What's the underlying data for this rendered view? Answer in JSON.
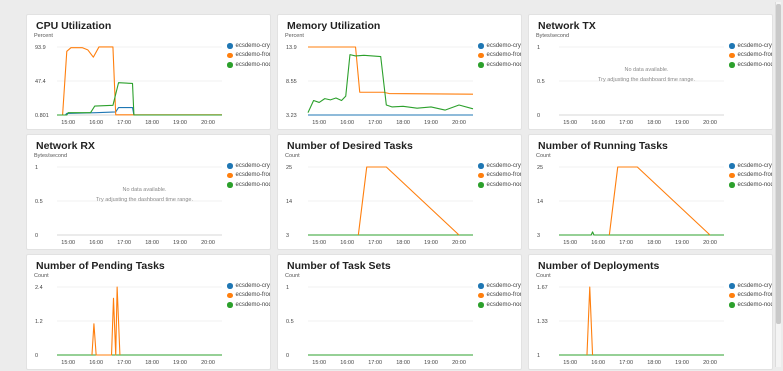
{
  "colors": {
    "crystal": "#1f77b4",
    "frontend": "#ff7f0e",
    "nodejs": "#2ca02c"
  },
  "time_ticks": [
    "15:00",
    "16:00",
    "17:00",
    "18:00",
    "19:00",
    "20:00"
  ],
  "widgets": [
    {
      "title": "CPU Utilization",
      "unit": "Percent",
      "yticks": [
        "93.9",
        "47.4",
        "0.801"
      ],
      "yrange": [
        0.801,
        93.9
      ],
      "legend": [
        "ecsdemo-crystal",
        "ecsdemo-frontend",
        "ecsdemo-nodejs"
      ],
      "series": [
        {
          "name": "ecsdemo-crystal",
          "color": "#1f77b4",
          "points": [
            [
              14.6,
              0.8
            ],
            [
              14.9,
              0.8
            ],
            [
              14.95,
              3
            ],
            [
              16.0,
              4
            ],
            [
              16.7,
              5
            ],
            [
              16.8,
              11
            ],
            [
              17.3,
              11
            ],
            [
              17.35,
              0.8
            ],
            [
              20.5,
              0.8
            ]
          ]
        },
        {
          "name": "ecsdemo-frontend",
          "color": "#ff7f0e",
          "points": [
            [
              14.6,
              0.8
            ],
            [
              14.8,
              0.8
            ],
            [
              14.95,
              88
            ],
            [
              15.1,
              93
            ],
            [
              15.5,
              93
            ],
            [
              15.7,
              90
            ],
            [
              15.9,
              80
            ],
            [
              16.1,
              94
            ],
            [
              16.6,
              94
            ],
            [
              16.7,
              1
            ],
            [
              20.5,
              1
            ]
          ]
        },
        {
          "name": "ecsdemo-nodejs",
          "color": "#2ca02c",
          "points": [
            [
              14.6,
              0.8
            ],
            [
              14.95,
              0.8
            ],
            [
              15.0,
              4
            ],
            [
              15.8,
              4
            ],
            [
              15.95,
              13
            ],
            [
              16.6,
              14
            ],
            [
              16.8,
              45
            ],
            [
              17.3,
              44
            ],
            [
              17.35,
              0.8
            ],
            [
              20.5,
              0.8
            ]
          ]
        }
      ]
    },
    {
      "title": "Memory Utilization",
      "unit": "Percent",
      "yticks": [
        "13.9",
        "8.55",
        "3.23"
      ],
      "yrange": [
        3.23,
        13.9
      ],
      "legend": [
        "ecsdemo-crystal",
        "ecsdemo-frontend",
        "ecsdemo-nodejs"
      ],
      "series": [
        {
          "name": "ecsdemo-crystal",
          "color": "#1f77b4",
          "points": [
            [
              14.6,
              3.23
            ],
            [
              20.5,
              3.23
            ]
          ]
        },
        {
          "name": "ecsdemo-frontend",
          "color": "#ff7f0e",
          "points": [
            [
              14.6,
              13.9
            ],
            [
              15.7,
              13.9
            ],
            [
              16.3,
              13.9
            ],
            [
              16.45,
              6.8
            ],
            [
              17.3,
              6.8
            ],
            [
              17.5,
              6.6
            ],
            [
              20.5,
              6.5
            ]
          ]
        },
        {
          "name": "ecsdemo-nodejs",
          "color": "#2ca02c",
          "points": [
            [
              14.6,
              3.6
            ],
            [
              14.8,
              5.5
            ],
            [
              15.0,
              5.2
            ],
            [
              15.2,
              5.8
            ],
            [
              15.4,
              5.6
            ],
            [
              15.6,
              5.9
            ],
            [
              15.8,
              5.5
            ],
            [
              15.95,
              6.2
            ],
            [
              16.1,
              12.7
            ],
            [
              16.3,
              12.5
            ],
            [
              16.6,
              12.6
            ],
            [
              17.2,
              12.4
            ],
            [
              17.4,
              4.8
            ],
            [
              17.6,
              4.5
            ],
            [
              18.0,
              4.6
            ],
            [
              18.5,
              4.3
            ],
            [
              19.0,
              4.5
            ],
            [
              19.5,
              4.0
            ],
            [
              20.0,
              4.8
            ],
            [
              20.5,
              4.2
            ]
          ]
        }
      ]
    },
    {
      "title": "Network TX",
      "unit": "Bytes/second",
      "yticks": [
        "1",
        "0.5",
        "0"
      ],
      "yrange": [
        0,
        1
      ],
      "legend": [
        "ecsdemo-crystal",
        "ecsdemo-frontend",
        "ecsdemo-nodejs"
      ],
      "no_data": [
        "No data available.",
        "Try adjusting the dashboard time range."
      ],
      "series": []
    },
    {
      "title": "Network RX",
      "unit": "Bytes/second",
      "yticks": [
        "1",
        "0.5",
        "0"
      ],
      "yrange": [
        0,
        1
      ],
      "legend": [
        "ecsdemo-crystal",
        "ecsdemo-frontend",
        "ecsdemo-nodejs"
      ],
      "no_data": [
        "No data available.",
        "Try adjusting the dashboard time range."
      ],
      "series": []
    },
    {
      "title": "Number of Desired Tasks",
      "unit": "Count",
      "yticks": [
        "25",
        "14",
        "3"
      ],
      "yrange": [
        3,
        25
      ],
      "legend": [
        "ecsdemo-crystal",
        "ecsdemo-frontend",
        "ecsdemo-nodejs"
      ],
      "series": [
        {
          "name": "ecsdemo-nodejs",
          "color": "#2ca02c",
          "points": [
            [
              14.6,
              3
            ],
            [
              20.5,
              3
            ]
          ]
        },
        {
          "name": "ecsdemo-frontend",
          "color": "#ff7f0e",
          "points": [
            [
              16.4,
              3
            ],
            [
              16.7,
              25
            ],
            [
              17.4,
              25
            ],
            [
              20.0,
              3
            ]
          ]
        }
      ]
    },
    {
      "title": "Number of Running Tasks",
      "unit": "Count",
      "yticks": [
        "25",
        "14",
        "3"
      ],
      "yrange": [
        3,
        25
      ],
      "legend": [
        "ecsdemo-crystal",
        "ecsdemo-frontend",
        "ecsdemo-nodejs"
      ],
      "series": [
        {
          "name": "ecsdemo-nodejs",
          "color": "#2ca02c",
          "points": [
            [
              14.6,
              3
            ],
            [
              15.75,
              3
            ],
            [
              15.8,
              4
            ],
            [
              15.85,
              3
            ],
            [
              20.5,
              3
            ]
          ]
        },
        {
          "name": "ecsdemo-frontend",
          "color": "#ff7f0e",
          "points": [
            [
              16.4,
              3
            ],
            [
              16.7,
              25
            ],
            [
              17.4,
              25
            ],
            [
              20.0,
              3
            ]
          ]
        }
      ]
    },
    {
      "title": "Number of Pending Tasks",
      "unit": "Count",
      "yticks": [
        "2.4",
        "1.2",
        "0"
      ],
      "yrange": [
        0,
        2.4
      ],
      "legend": [
        "ecsdemo-crystal",
        "ecsdemo-frontend",
        "ecsdemo-nodejs"
      ],
      "series": [
        {
          "name": "ecsdemo-nodejs",
          "color": "#2ca02c",
          "points": [
            [
              14.6,
              0
            ],
            [
              20.5,
              0
            ]
          ]
        },
        {
          "name": "ecsdemo-frontend",
          "color": "#ff7f0e",
          "points": [
            [
              15.85,
              0
            ],
            [
              15.92,
              1.1
            ],
            [
              16.0,
              0
            ],
            [
              16.55,
              0
            ],
            [
              16.62,
              2.0
            ],
            [
              16.7,
              0
            ],
            [
              16.75,
              2.4
            ],
            [
              16.85,
              0
            ]
          ]
        }
      ]
    },
    {
      "title": "Number of Task Sets",
      "unit": "Count",
      "yticks": [
        "1",
        "0.5",
        "0"
      ],
      "yrange": [
        0,
        1
      ],
      "legend": [
        "ecsdemo-crystal",
        "ecsdemo-frontend",
        "ecsdemo-nodejs"
      ],
      "series": [
        {
          "name": "ecsdemo-nodejs",
          "color": "#2ca02c",
          "points": [
            [
              14.6,
              0
            ],
            [
              20.5,
              0
            ]
          ]
        }
      ]
    },
    {
      "title": "Number of Deployments",
      "unit": "Count",
      "yticks": [
        "1.67",
        "1.33",
        "1"
      ],
      "yrange": [
        1,
        1.67
      ],
      "legend": [
        "ecsdemo-crystal",
        "ecsdemo-frontend",
        "ecsdemo-nodejs"
      ],
      "series": [
        {
          "name": "ecsdemo-nodejs",
          "color": "#2ca02c",
          "points": [
            [
              14.6,
              1
            ],
            [
              20.5,
              1
            ]
          ]
        },
        {
          "name": "ecsdemo-frontend",
          "color": "#ff7f0e",
          "points": [
            [
              15.6,
              1
            ],
            [
              15.7,
              1.67
            ],
            [
              15.8,
              1
            ]
          ]
        }
      ]
    }
  ]
}
